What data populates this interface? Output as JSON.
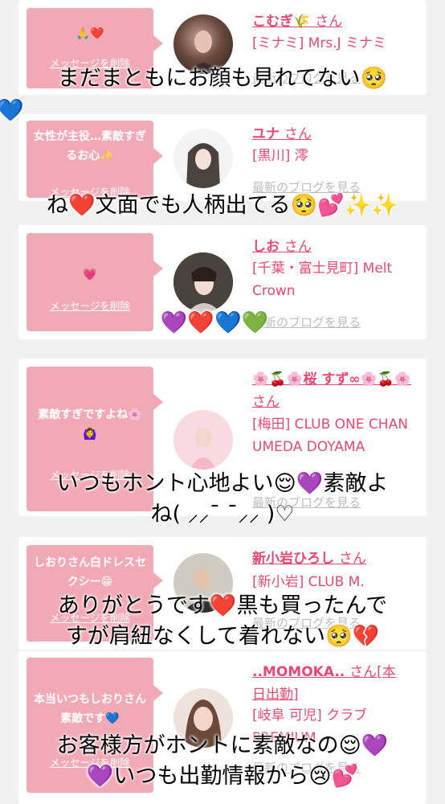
{
  "cards": [
    {
      "bubble_text": "🙏❤️",
      "delete_label": "メッセージを削除",
      "name": "こむぎ🌾",
      "san": "さん",
      "shop": "[ミナミ] Mrs.J ミナミ",
      "blog": "最新のブログを見る"
    },
    {
      "bubble_text": "女性が主役…素敵すぎるお心✨",
      "delete_label": "メッセージを削除",
      "name": "ユナ",
      "san": "さん",
      "shop": "[黒川] 澪",
      "blog": "最新のブログを見る"
    },
    {
      "bubble_text": "💗",
      "delete_label": "メッセージを削除",
      "name": "しお",
      "san": "さん",
      "shop": "[千葉・富士見町] Melt Crown",
      "blog": "最新のブログを見る"
    },
    {
      "bubble_text": "素敵すぎですよね🌸🙆‍♀️",
      "delete_label": "メッセージを削除",
      "name": "🌸🍒🌸桜 すず∞🌸🍒🌸",
      "san": "さん",
      "shop": "[梅田] CLUB ONE CHAN UMEDA DOYAMA",
      "blog": "最新のブログを見る"
    },
    {
      "bubble_text": "しおりさん白ドレスセクシー😁",
      "delete_label": "メッセージを削除",
      "name": "新小岩ひろし",
      "san": "さん",
      "shop": "[新小岩] CLUB M.",
      "blog": "最新のブログを見る"
    },
    {
      "bubble_text": "本当いつもしおりさん素敵です💙",
      "delete_label": "メッセージを削除",
      "name": "..MOMOKA..",
      "san": "さん[本日出勤]",
      "shop": "[岐阜 可児] クラブ PREMIUM",
      "blog": "最新のブログを見る"
    }
  ],
  "overlays": [
    "まだまともにお顔も見れてない🥺",
    "💙",
    "ね❤️文面でも人柄出てる🥺💕✨✨",
    "💜❤️💙💚",
    "いつもホント心地よい😌💜素敵よ",
    "ね( ⸝⸝¯ ¯⸝⸝ )♡",
    "ありがとうです❤️黒も買ったんで",
    "すが肩紐なくして着れない🥺💔",
    "お客様方がホントに素敵なの😌💜",
    "💜いつも出勤情報から😢💕"
  ]
}
